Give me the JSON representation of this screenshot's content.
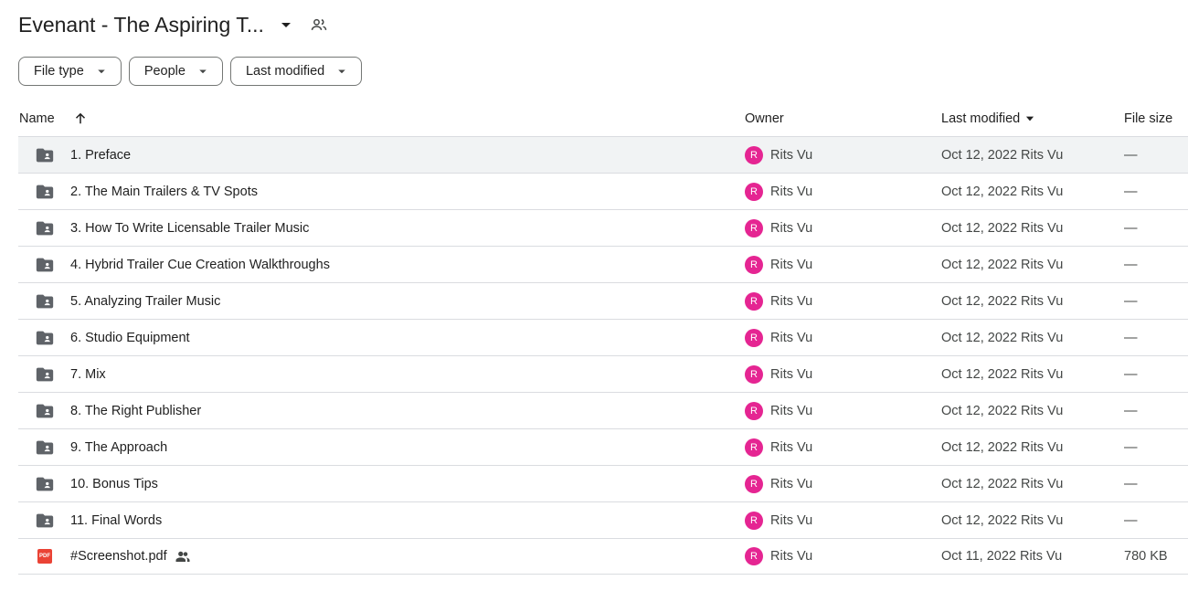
{
  "header": {
    "title": "Evenant - The Aspiring T...",
    "caret_icon": "arrow-drop-down-icon",
    "share_icon": "people-icon"
  },
  "filters": [
    {
      "label": "File type"
    },
    {
      "label": "People"
    },
    {
      "label": "Last modified"
    }
  ],
  "columns": {
    "name": "Name",
    "owner": "Owner",
    "last_modified": "Last modified",
    "file_size": "File size"
  },
  "colors": {
    "avatar": "#e52592",
    "pdf": "#ea4335",
    "folder": "#5f6368",
    "selected_row": "#f1f3f4"
  },
  "rows": [
    {
      "name": "1. Preface",
      "type": "folder",
      "owner": "Rits Vu",
      "avatar": "R",
      "modified": "Oct 12, 2022 Rits Vu",
      "size": "—"
    },
    {
      "name": "2. The Main Trailers & TV Spots",
      "type": "folder",
      "owner": "Rits Vu",
      "avatar": "R",
      "modified": "Oct 12, 2022 Rits Vu",
      "size": "—"
    },
    {
      "name": "3. How To Write Licensable Trailer Music",
      "type": "folder",
      "owner": "Rits Vu",
      "avatar": "R",
      "modified": "Oct 12, 2022 Rits Vu",
      "size": "—"
    },
    {
      "name": "4. Hybrid Trailer Cue Creation Walkthroughs",
      "type": "folder",
      "owner": "Rits Vu",
      "avatar": "R",
      "modified": "Oct 12, 2022 Rits Vu",
      "size": "—"
    },
    {
      "name": "5. Analyzing Trailer Music",
      "type": "folder",
      "owner": "Rits Vu",
      "avatar": "R",
      "modified": "Oct 12, 2022 Rits Vu",
      "size": "—"
    },
    {
      "name": "6. Studio Equipment",
      "type": "folder",
      "owner": "Rits Vu",
      "avatar": "R",
      "modified": "Oct 12, 2022 Rits Vu",
      "size": "—"
    },
    {
      "name": "7. Mix",
      "type": "folder",
      "owner": "Rits Vu",
      "avatar": "R",
      "modified": "Oct 12, 2022 Rits Vu",
      "size": "—"
    },
    {
      "name": "8. The Right Publisher",
      "type": "folder",
      "owner": "Rits Vu",
      "avatar": "R",
      "modified": "Oct 12, 2022 Rits Vu",
      "size": "—"
    },
    {
      "name": "9. The Approach",
      "type": "folder",
      "owner": "Rits Vu",
      "avatar": "R",
      "modified": "Oct 12, 2022 Rits Vu",
      "size": "—"
    },
    {
      "name": "10. Bonus Tips",
      "type": "folder",
      "owner": "Rits Vu",
      "avatar": "R",
      "modified": "Oct 12, 2022 Rits Vu",
      "size": "—"
    },
    {
      "name": "11. Final Words",
      "type": "folder",
      "owner": "Rits Vu",
      "avatar": "R",
      "modified": "Oct 12, 2022 Rits Vu",
      "size": "—"
    },
    {
      "name": "#Screenshot.pdf",
      "type": "pdf",
      "pdf_label": "PDF",
      "shared": true,
      "owner": "Rits Vu",
      "avatar": "R",
      "modified": "Oct 11, 2022 Rits Vu",
      "size": "780 KB"
    }
  ]
}
